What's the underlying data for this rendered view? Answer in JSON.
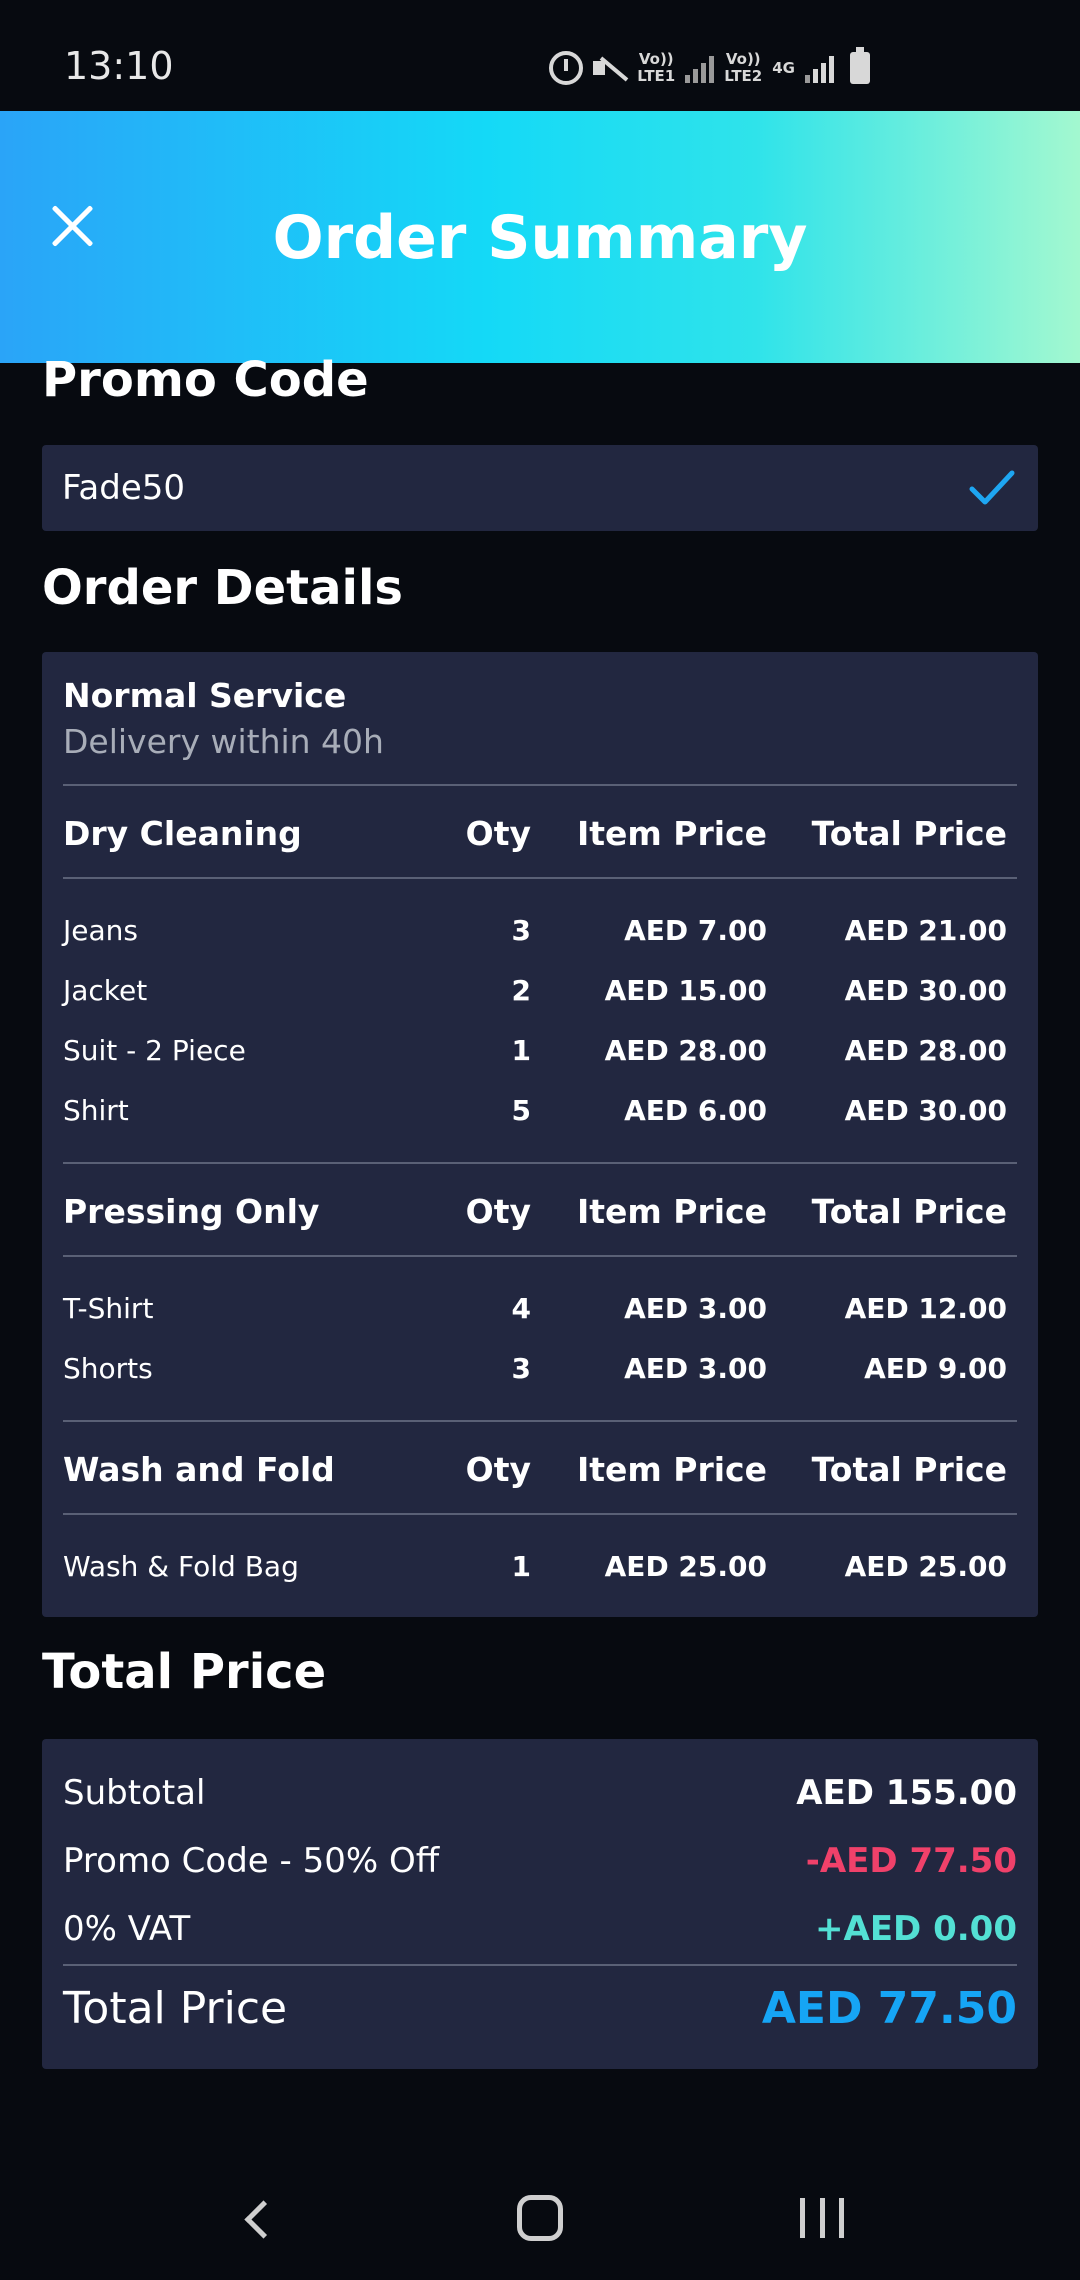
{
  "status": {
    "time": "13:10",
    "sim1_top": "Vo))",
    "sim1_bottom": "LTE1",
    "sim2_top": "Vo))",
    "sim2_bottom": "LTE2",
    "network": "4G"
  },
  "header": {
    "title": "Order Summary"
  },
  "promo": {
    "heading": "Promo Code",
    "value": "Fade50",
    "accent": "#1ea6f2"
  },
  "order_details": {
    "heading": "Order Details",
    "service_title": "Normal Service",
    "service_subtitle": "Delivery within 40h",
    "sections": [
      {
        "name": "Dry Cleaning",
        "qty_header": "Oty",
        "item_price_header": "Item Price",
        "total_price_header": "Total Price",
        "items": [
          {
            "name": "Jeans",
            "qty": "3",
            "price": "AED 7.00",
            "total": "AED 21.00"
          },
          {
            "name": "Jacket",
            "qty": "2",
            "price": "AED 15.00",
            "total": "AED 30.00"
          },
          {
            "name": "Suit - 2 Piece",
            "qty": "1",
            "price": "AED 28.00",
            "total": "AED 28.00"
          },
          {
            "name": "Shirt",
            "qty": "5",
            "price": "AED 6.00",
            "total": "AED 30.00"
          }
        ]
      },
      {
        "name": "Pressing Only",
        "qty_header": "Oty",
        "item_price_header": "Item Price",
        "total_price_header": "Total Price",
        "items": [
          {
            "name": "T-Shirt",
            "qty": "4",
            "price": "AED 3.00",
            "total": "AED 12.00"
          },
          {
            "name": "Shorts",
            "qty": "3",
            "price": "AED 3.00",
            "total": "AED 9.00"
          }
        ]
      },
      {
        "name": "Wash and Fold",
        "qty_header": "Oty",
        "item_price_header": "Item Price",
        "total_price_header": "Total Price",
        "items": [
          {
            "name": "Wash & Fold Bag",
            "qty": "1",
            "price": "AED 25.00",
            "total": "AED 25.00"
          }
        ]
      }
    ]
  },
  "totals": {
    "heading": "Total Price",
    "subtotal_label": "Subtotal",
    "subtotal_value": "AED 155.00",
    "promo_label": "Promo Code - 50% Off",
    "promo_value": "-AED 77.50",
    "vat_label": "0% VAT",
    "vat_value": "+AED 0.00",
    "total_label": "Total Price",
    "total_value": "AED 77.50"
  },
  "colors": {
    "background": "#070a10",
    "card": "#222740",
    "discount": "#f0416a",
    "vat": "#53e0d4",
    "total": "#16a5f5"
  }
}
